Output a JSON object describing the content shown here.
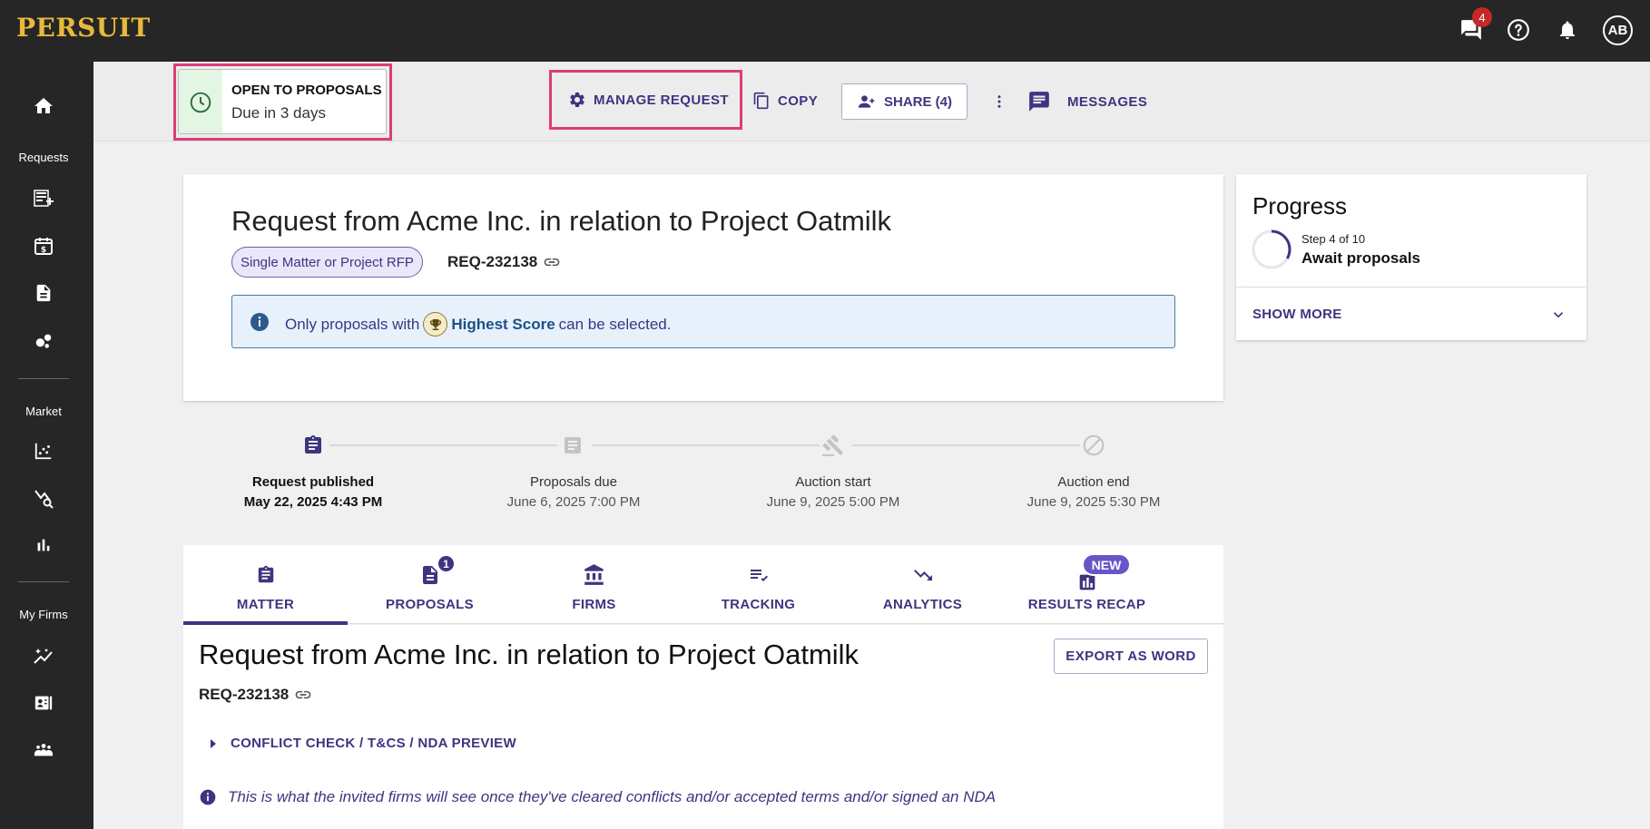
{
  "app": {
    "logo": "PERSUIT"
  },
  "topbar": {
    "messages_badge": "4",
    "avatar_initials": "AB"
  },
  "sidebar": {
    "sections": [
      {
        "label": "Requests"
      },
      {
        "label": "Market"
      },
      {
        "label": "My Firms"
      }
    ]
  },
  "status": {
    "title": "OPEN TO PROPOSALS",
    "subtitle": "Due in 3 days",
    "accent": "#e3f6e3"
  },
  "actions": {
    "manage": "MANAGE REQUEST",
    "copy": "COPY",
    "share": "SHARE (4)",
    "messages": "MESSAGES"
  },
  "request": {
    "title": "Request from Acme Inc. in relation to Project Oatmilk",
    "chip": "Single Matter or Project RFP",
    "id": "REQ-232138",
    "info_prefix": "Only proposals with",
    "info_highlight": "Highest Score",
    "info_suffix": "can be selected."
  },
  "timeline": [
    {
      "label": "Request published",
      "date": "May 22, 2025 4:43 PM"
    },
    {
      "label": "Proposals due",
      "date": "June 6, 2025 7:00 PM"
    },
    {
      "label": "Auction start",
      "date": "June 9, 2025 5:00 PM"
    },
    {
      "label": "Auction end",
      "date": "June 9, 2025 5:30 PM"
    }
  ],
  "tabs": [
    {
      "label": "MATTER",
      "active": true
    },
    {
      "label": "PROPOSALS",
      "badge": "1"
    },
    {
      "label": "FIRMS"
    },
    {
      "label": "TRACKING"
    },
    {
      "label": "ANALYTICS"
    },
    {
      "label": "RESULTS RECAP",
      "new_label": "NEW"
    }
  ],
  "content": {
    "title": "Request from Acme Inc. in relation to Project Oatmilk",
    "id": "REQ-232138",
    "export": "EXPORT AS WORD",
    "conflict": "CONFLICT CHECK / T&CS / NDA PREVIEW",
    "note": "This is what the invited firms will see once they've cleared conflicts and/or accepted terms and/or signed an NDA"
  },
  "progress": {
    "title": "Progress",
    "step": "Step 4 of 10",
    "step_name": "Await proposals",
    "show_more": "SHOW MORE"
  },
  "colors": {
    "accent": "#3d3580",
    "highlight_outline": "#dc3d7a",
    "topbar": "#262626"
  }
}
